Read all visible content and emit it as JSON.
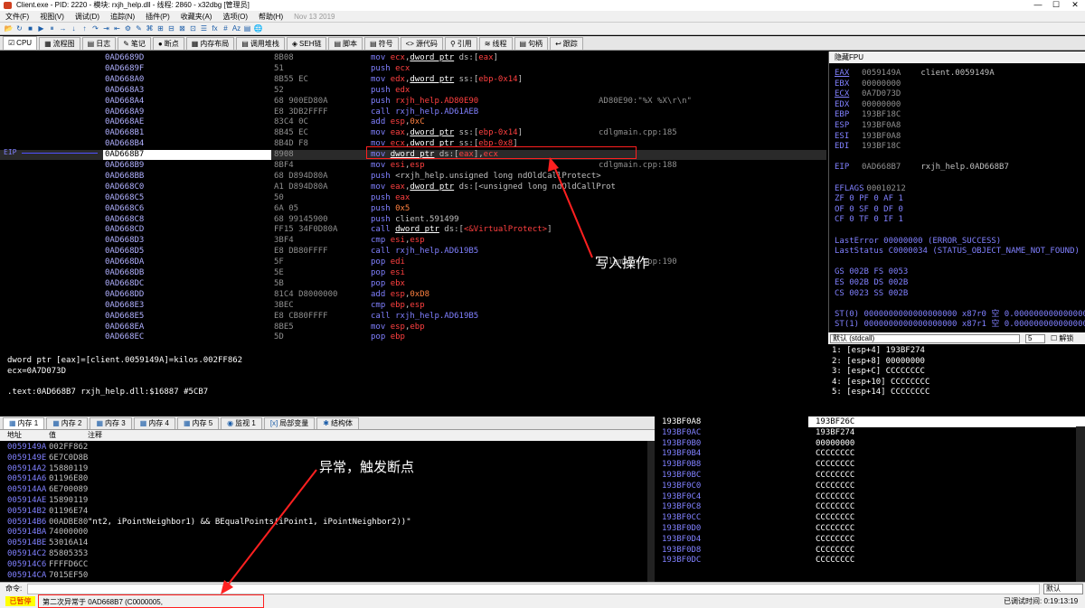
{
  "window": {
    "title": "Client.exe - PID: 2220 - 模块: rxjh_help.dll - 线程: 2860 - x32dbg [管理员]",
    "minimize": "—",
    "maximize": "☐",
    "close": "✕"
  },
  "menu": [
    "文件(F)",
    "视图(V)",
    "调试(D)",
    "追踪(N)",
    "插件(P)",
    "收藏夹(A)",
    "选项(O)",
    "帮助(H)"
  ],
  "menu_date": "Nov 13 2019",
  "toolbar_icons": [
    "📂",
    "↻",
    "■",
    "▶",
    "⏸",
    "→",
    "↓",
    "↑",
    "↷",
    "⇥",
    "⇤",
    "⚙",
    "✎",
    "⌘",
    "⊞",
    "⊟",
    "⊠",
    "⊡",
    "☰",
    "fx",
    "#",
    "Az",
    "▤",
    "🌐"
  ],
  "tabs": [
    {
      "icon": "☑",
      "label": "CPU"
    },
    {
      "icon": "▦",
      "label": "流程图"
    },
    {
      "icon": "▤",
      "label": "日志"
    },
    {
      "icon": "✎",
      "label": "笔记"
    },
    {
      "icon": "●",
      "label": "断点"
    },
    {
      "icon": "▦",
      "label": "内存布局"
    },
    {
      "icon": "▤",
      "label": "调用堆栈"
    },
    {
      "icon": "◈",
      "label": "SEH链"
    },
    {
      "icon": "▤",
      "label": "脚本"
    },
    {
      "icon": "▤",
      "label": "符号"
    },
    {
      "icon": "<>",
      "label": "源代码"
    },
    {
      "icon": "⚲",
      "label": "引用"
    },
    {
      "icon": "≋",
      "label": "线程"
    },
    {
      "icon": "▤",
      "label": "句柄"
    },
    {
      "icon": "↩",
      "label": "跟踪"
    }
  ],
  "disasm": [
    {
      "addr": "0AD6689D",
      "hex": "8B08",
      "asm": [
        [
          "ins",
          "mov "
        ],
        [
          "reg",
          "ecx"
        ],
        [
          "t",
          ","
        ],
        [
          "u",
          "dword ptr"
        ],
        [
          "t",
          " ds:["
        ],
        [
          "reg",
          "eax"
        ],
        [
          "t",
          "]"
        ]
      ],
      "cmt": ""
    },
    {
      "addr": "0AD6689F",
      "hex": "51",
      "asm": [
        [
          "ins",
          "push "
        ],
        [
          "reg",
          "ecx"
        ]
      ],
      "cmt": ""
    },
    {
      "addr": "0AD668A0",
      "hex": "8B55 EC",
      "asm": [
        [
          "ins",
          "mov "
        ],
        [
          "reg",
          "edx"
        ],
        [
          "t",
          ","
        ],
        [
          "u",
          "dword ptr"
        ],
        [
          "t",
          " ss:["
        ],
        [
          "reg",
          "ebp-0x14"
        ],
        [
          "t",
          "]"
        ]
      ],
      "cmt": ""
    },
    {
      "addr": "0AD668A3",
      "hex": "52",
      "asm": [
        [
          "ins",
          "push "
        ],
        [
          "reg",
          "edx"
        ]
      ],
      "cmt": ""
    },
    {
      "addr": "0AD668A4",
      "hex": "68 900ED80A",
      "asm": [
        [
          "ins",
          "push "
        ],
        [
          "reg",
          "rxjh_help.AD80E90"
        ]
      ],
      "cmt": "AD80E90:\"%X %X\\r\\n\""
    },
    {
      "addr": "0AD668A9",
      "hex": "E8 3DB2FFFF",
      "asm": [
        [
          "ins",
          "call "
        ],
        [
          "cl",
          "rxjh_help.AD61AEB"
        ]
      ],
      "cmt": ""
    },
    {
      "addr": "0AD668AE",
      "hex": "83C4 0C",
      "asm": [
        [
          "ins",
          "add "
        ],
        [
          "reg",
          "esp"
        ],
        [
          "t",
          ","
        ],
        [
          "imm",
          "0xC"
        ]
      ],
      "cmt": ""
    },
    {
      "addr": "0AD668B1",
      "hex": "8B45 EC",
      "asm": [
        [
          "ins",
          "mov "
        ],
        [
          "reg",
          "eax"
        ],
        [
          "t",
          ","
        ],
        [
          "u",
          "dword ptr"
        ],
        [
          "t",
          " ss:["
        ],
        [
          "reg",
          "ebp-0x14"
        ],
        [
          "t",
          "]"
        ]
      ],
      "cmt": "cdlgmain.cpp:185"
    },
    {
      "addr": "0AD668B4",
      "hex": "8B4D F8",
      "asm": [
        [
          "ins",
          "mov "
        ],
        [
          "reg",
          "ecx"
        ],
        [
          "t",
          ","
        ],
        [
          "u",
          "dword ptr"
        ],
        [
          "t",
          " ss:["
        ],
        [
          "reg",
          "ebp-0x8"
        ],
        [
          "t",
          "]"
        ]
      ],
      "cmt": ""
    },
    {
      "addr": "0AD668B7",
      "hex": "8908",
      "asm": [
        [
          "ins",
          "mov "
        ],
        [
          "u",
          "dword ptr"
        ],
        [
          "t",
          " ds:["
        ],
        [
          "reg",
          "eax"
        ],
        [
          "t",
          "],"
        ],
        [
          "reg",
          "ecx"
        ]
      ],
      "cmt": "",
      "sel": true
    },
    {
      "addr": "0AD668B9",
      "hex": "8BF4",
      "asm": [
        [
          "ins",
          "mov "
        ],
        [
          "reg",
          "esi"
        ],
        [
          "t",
          ","
        ],
        [
          "reg",
          "esp"
        ]
      ],
      "cmt": "cdlgmain.cpp:188"
    },
    {
      "addr": "0AD668BB",
      "hex": "68 D894D80A",
      "asm": [
        [
          "ins",
          "push "
        ],
        [
          "t",
          "<rxjh_help.unsigned long ndOldCallProtect>"
        ]
      ],
      "cmt": ""
    },
    {
      "addr": "0AD668C0",
      "hex": "A1 D894D80A",
      "asm": [
        [
          "ins",
          "mov "
        ],
        [
          "reg",
          "eax"
        ],
        [
          "t",
          ","
        ],
        [
          "u",
          "dword ptr"
        ],
        [
          "t",
          " ds:[<unsigned long ndOldCallProt"
        ]
      ],
      "cmt": ""
    },
    {
      "addr": "0AD668C5",
      "hex": "50",
      "asm": [
        [
          "ins",
          "push "
        ],
        [
          "reg",
          "eax"
        ]
      ],
      "cmt": ""
    },
    {
      "addr": "0AD668C6",
      "hex": "6A 05",
      "asm": [
        [
          "ins",
          "push "
        ],
        [
          "imm",
          "0x5"
        ]
      ],
      "cmt": ""
    },
    {
      "addr": "0AD668C8",
      "hex": "68 99145900",
      "asm": [
        [
          "ins",
          "push "
        ],
        [
          "t",
          "client.591499"
        ]
      ],
      "cmt": ""
    },
    {
      "addr": "0AD668CD",
      "hex": "FF15 34F0D80A",
      "asm": [
        [
          "ins",
          "call "
        ],
        [
          "u",
          "dword ptr"
        ],
        [
          "t",
          " ds:["
        ],
        [
          "reg",
          "<&VirtualProtect>"
        ],
        [
          "t",
          "]"
        ]
      ],
      "cmt": ""
    },
    {
      "addr": "0AD668D3",
      "hex": "3BF4",
      "asm": [
        [
          "ins",
          "cmp "
        ],
        [
          "reg",
          "esi"
        ],
        [
          "t",
          ","
        ],
        [
          "reg",
          "esp"
        ]
      ],
      "cmt": ""
    },
    {
      "addr": "0AD668D5",
      "hex": "E8 DB80FFFF",
      "asm": [
        [
          "ins",
          "call "
        ],
        [
          "cl",
          "rxjh_help.AD619B5"
        ]
      ],
      "cmt": ""
    },
    {
      "addr": "0AD668DA",
      "hex": "5F",
      "asm": [
        [
          "ins",
          "pop "
        ],
        [
          "reg",
          "edi"
        ]
      ],
      "cmt": "cdlgmain.cpp:190"
    },
    {
      "addr": "0AD668DB",
      "hex": "5E",
      "asm": [
        [
          "ins",
          "pop "
        ],
        [
          "reg",
          "esi"
        ]
      ],
      "cmt": ""
    },
    {
      "addr": "0AD668DC",
      "hex": "5B",
      "asm": [
        [
          "ins",
          "pop "
        ],
        [
          "reg",
          "ebx"
        ]
      ],
      "cmt": ""
    },
    {
      "addr": "0AD668DD",
      "hex": "81C4 D8000000",
      "asm": [
        [
          "ins",
          "add "
        ],
        [
          "reg",
          "esp"
        ],
        [
          "t",
          ","
        ],
        [
          "imm",
          "0xD8"
        ]
      ],
      "cmt": ""
    },
    {
      "addr": "0AD668E3",
      "hex": "3BEC",
      "asm": [
        [
          "ins",
          "cmp "
        ],
        [
          "reg",
          "ebp"
        ],
        [
          "t",
          ","
        ],
        [
          "reg",
          "esp"
        ]
      ],
      "cmt": ""
    },
    {
      "addr": "0AD668E5",
      "hex": "E8 CB80FFFF",
      "asm": [
        [
          "ins",
          "call "
        ],
        [
          "cl",
          "rxjh_help.AD619B5"
        ]
      ],
      "cmt": ""
    },
    {
      "addr": "0AD668EA",
      "hex": "8BE5",
      "asm": [
        [
          "ins",
          "mov "
        ],
        [
          "reg",
          "esp"
        ],
        [
          "t",
          ","
        ],
        [
          "reg",
          "ebp"
        ]
      ],
      "cmt": ""
    },
    {
      "addr": "0AD668EC",
      "hex": "5D",
      "asm": [
        [
          "ins",
          "pop "
        ],
        [
          "reg",
          "ebp"
        ]
      ],
      "cmt": ""
    }
  ],
  "eip_label": "EIP",
  "annotation_write": "写入操作",
  "annotation_exception": "异常，触发断点",
  "registers": {
    "header": "隐藏FPU",
    "rows": [
      {
        "name": "EAX",
        "val": "0059149A",
        "desc": "client.0059149A",
        "u": true
      },
      {
        "name": "EBX",
        "val": "00000000",
        "desc": ""
      },
      {
        "name": "ECX",
        "val": "0A7D073D",
        "desc": "",
        "u": true
      },
      {
        "name": "EDX",
        "val": "00000000",
        "desc": ""
      },
      {
        "name": "EBP",
        "val": "193BF18C",
        "desc": ""
      },
      {
        "name": "ESP",
        "val": "193BF0A8",
        "desc": ""
      },
      {
        "name": "ESI",
        "val": "193BF0A8",
        "desc": ""
      },
      {
        "name": "EDI",
        "val": "193BF18C",
        "desc": ""
      },
      {
        "name": "",
        "val": "",
        "desc": ""
      },
      {
        "name": "EIP",
        "val": "0AD668B7",
        "desc": "rxjh_help.0AD668B7"
      },
      {
        "name": "",
        "val": "",
        "desc": ""
      },
      {
        "name": "EFLAGS",
        "val": "  00010212",
        "desc": ""
      },
      {
        "name": "",
        "val": "ZF 0  PF 0  AF 1",
        "desc": "",
        "raw": true
      },
      {
        "name": "",
        "val": "OF 0  SF 0  DF 0",
        "desc": "",
        "raw": true
      },
      {
        "name": "",
        "val": "CF 0  TF 0  IF 1",
        "desc": "",
        "raw": true
      },
      {
        "name": "",
        "val": "",
        "desc": ""
      },
      {
        "name": "",
        "val": "LastError  00000000 (ERROR_SUCCESS)",
        "desc": "",
        "raw": true
      },
      {
        "name": "",
        "val": "LastStatus C0000034 (STATUS_OBJECT_NAME_NOT_FOUND)",
        "desc": "",
        "raw": true
      },
      {
        "name": "",
        "val": "",
        "desc": ""
      },
      {
        "name": "",
        "val": "GS 002B  FS 0053",
        "desc": "",
        "raw": true
      },
      {
        "name": "",
        "val": "ES 002B  DS 002B",
        "desc": "",
        "raw": true
      },
      {
        "name": "",
        "val": "CS 0023  SS 002B",
        "desc": "",
        "raw": true
      },
      {
        "name": "",
        "val": "",
        "desc": ""
      },
      {
        "name": "",
        "val": "ST(0) 0000000000000000000 x87r0 空 0.000000000000000000",
        "desc": "",
        "raw": true
      },
      {
        "name": "",
        "val": "ST(1) 0000000000000000000 x87r1 空 0.000000000000000000",
        "desc": "",
        "raw": true
      }
    ]
  },
  "callconv": {
    "label": "默认 (stdcall)",
    "count": "5",
    "unlock": "解锁"
  },
  "stack_args": [
    "1: [esp+4] 193BF274",
    "2: [esp+8] 00000000",
    "3: [esp+C] CCCCCCCC",
    "4: [esp+10] CCCCCCCC",
    "5: [esp+14] CCCCCCCC"
  ],
  "info": [
    "dword ptr [eax]=[client.0059149A]=kilos.002FF862",
    "ecx=0A7D073D",
    "",
    ".text:0AD668B7 rxjh_help.dll:$16887 #5CB7"
  ],
  "memtabs": [
    {
      "icon": "▦",
      "label": "内存 1"
    },
    {
      "icon": "▦",
      "label": "内存 2"
    },
    {
      "icon": "▦",
      "label": "内存 3"
    },
    {
      "icon": "▦",
      "label": "内存 4"
    },
    {
      "icon": "▦",
      "label": "内存 5"
    },
    {
      "icon": "◉",
      "label": "监视 1"
    },
    {
      "icon": "[x]",
      "label": "局部变量"
    },
    {
      "icon": "✱",
      "label": "结构体"
    }
  ],
  "memdump": {
    "cols": [
      "地址",
      "值",
      "注释"
    ],
    "rows": [
      {
        "a": "0059149A",
        "v": "002FF862",
        "c": ""
      },
      {
        "a": "0059149E",
        "v": "6E7C0D8B",
        "c": ""
      },
      {
        "a": "005914A2",
        "v": "15880119",
        "c": ""
      },
      {
        "a": "005914A6",
        "v": "01196E80",
        "c": ""
      },
      {
        "a": "005914AA",
        "v": "6E700089",
        "c": ""
      },
      {
        "a": "005914AE",
        "v": "15890119",
        "c": ""
      },
      {
        "a": "005914B2",
        "v": "01196E74",
        "c": ""
      },
      {
        "a": "005914B6",
        "v": "00ADBE80",
        "c": "\"nt2, iPointNeighbor1) && BEqualPoints(iPoint1, iPointNeighbor2))\""
      },
      {
        "a": "005914BA",
        "v": "74000000",
        "c": ""
      },
      {
        "a": "005914BE",
        "v": "53016A14",
        "c": ""
      },
      {
        "a": "005914C2",
        "v": "85805353",
        "c": ""
      },
      {
        "a": "005914C6",
        "v": "FFFFD6CC",
        "c": ""
      },
      {
        "a": "005914CA",
        "v": "7015EF50",
        "c": ""
      }
    ]
  },
  "stack": [
    {
      "a": "193BF0A8",
      "v": "193BF26C"
    },
    {
      "a": "193BF0AC",
      "v": "193BF274"
    },
    {
      "a": "193BF0B0",
      "v": "00000000"
    },
    {
      "a": "193BF0B4",
      "v": "CCCCCCCC"
    },
    {
      "a": "193BF0B8",
      "v": "CCCCCCCC"
    },
    {
      "a": "193BF0BC",
      "v": "CCCCCCCC"
    },
    {
      "a": "193BF0C0",
      "v": "CCCCCCCC"
    },
    {
      "a": "193BF0C4",
      "v": "CCCCCCCC"
    },
    {
      "a": "193BF0C8",
      "v": "CCCCCCCC"
    },
    {
      "a": "193BF0CC",
      "v": "CCCCCCCC"
    },
    {
      "a": "193BF0D0",
      "v": "CCCCCCCC"
    },
    {
      "a": "193BF0D4",
      "v": "CCCCCCCC"
    },
    {
      "a": "193BF0D8",
      "v": "CCCCCCCC"
    },
    {
      "a": "193BF0DC",
      "v": "CCCCCCCC"
    }
  ],
  "cmd": {
    "label": "命令:",
    "default": "默认"
  },
  "status": {
    "badge": "已暂停",
    "message": "第二次异常于 0AD668B7 (C0000005, EXCEPTION_ACCESS_VIOLATION)!",
    "right": "已调试时间: 0:19:13:19"
  }
}
